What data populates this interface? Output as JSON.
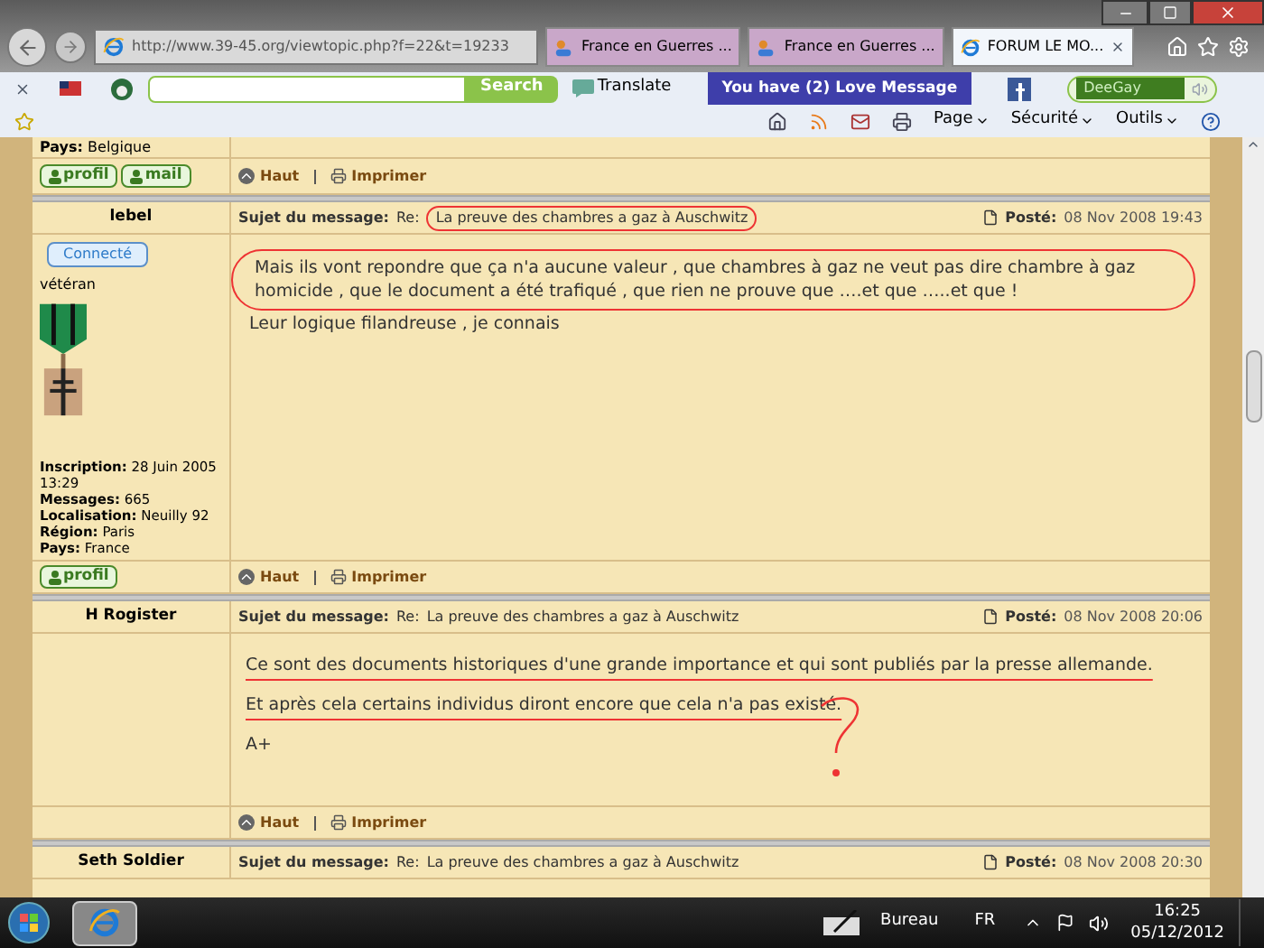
{
  "browser": {
    "address": "http://www.39-45.org/viewtopic.php?f=22&t=19233",
    "tabs": [
      {
        "label": "France en Guerres ...",
        "selected": false,
        "kind": "forum"
      },
      {
        "label": "France en Guerres ...",
        "selected": false,
        "kind": "forum"
      },
      {
        "label": "FORUM LE MO...",
        "selected": true,
        "kind": "ie"
      }
    ],
    "toolbar": {
      "search_button": "Search",
      "translate": "Translate",
      "love_message": "You have (2) Love Message",
      "profile_name": "DeeGay"
    },
    "command_bar": [
      "Page",
      "Sécurité",
      "Outils"
    ]
  },
  "forum": {
    "top_partial": {
      "label": "Pays:",
      "value": "Belgique"
    },
    "top_footer": {
      "buttons": [
        "profil",
        "mail"
      ],
      "links": [
        "Haut",
        "Imprimer"
      ]
    },
    "posts": [
      {
        "author": "lebel",
        "badge": "Connecté",
        "rank": "vétéran",
        "avatar": true,
        "profile": [
          {
            "label": "Inscription:",
            "value": "28 Juin 2005 13:29"
          },
          {
            "label": "Messages:",
            "value": "665"
          },
          {
            "label": "Localisation:",
            "value": "Neuilly 92"
          },
          {
            "label": "Région:",
            "value": "Paris"
          },
          {
            "label": "Pays:",
            "value": "France"
          }
        ],
        "subject_label": "Sujet du message:",
        "subject_prefix": "Re:",
        "subject": "La preuve des chambres a gaz à Auschwitz",
        "posted_label": "Posté:",
        "posted": "08 Nov 2008 19:43",
        "paragraphs": [
          "Mais ils vont repondre que ça n'a aucune valeur , que chambres à gaz ne veut pas dire chambre à gaz homicide , que le document a été trafiqué , que rien ne prouve que ….et que …..et que !",
          "Leur logique filandreuse , je connais"
        ],
        "kind": "circled",
        "footer_buttons": [
          "profil"
        ],
        "links": [
          "Haut",
          "Imprimer"
        ]
      },
      {
        "author": "H Rogister",
        "subject_label": "Sujet du message:",
        "subject_prefix": "Re:",
        "subject": "La preuve des chambres a gaz à Auschwitz",
        "posted_label": "Posté:",
        "posted": "08 Nov 2008 20:06",
        "paragraphs": [
          "Ce sont des documents historiques d'une grande importance et qui sont publiés par la presse allemande.",
          "Et après cela certains individus diront encore que cela n'a pas existé.",
          "A+"
        ],
        "kind": "underlined",
        "links": [
          "Haut",
          "Imprimer"
        ]
      },
      {
        "author": "Seth Soldier",
        "subject_label": "Sujet du message:",
        "subject_prefix": "Re:",
        "subject": "La preuve des chambres a gaz à Auschwitz",
        "posted_label": "Posté:",
        "posted": "08 Nov 2008 20:30",
        "kind": "plain"
      }
    ]
  },
  "taskbar": {
    "desktop": "Bureau",
    "language": "FR",
    "time": "16:25",
    "date": "05/12/2012"
  }
}
